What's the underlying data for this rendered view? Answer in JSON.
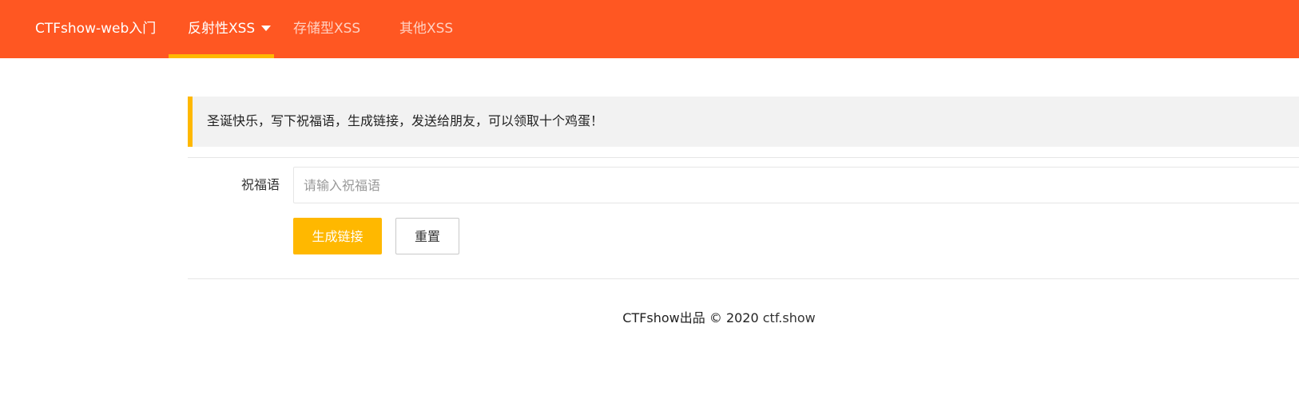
{
  "header": {
    "brand": "CTFshow-web入门",
    "nav": [
      {
        "label": "反射性XSS",
        "active": true,
        "has_dropdown": true
      },
      {
        "label": "存储型XSS",
        "active": false
      },
      {
        "label": "其他XSS",
        "active": false
      }
    ],
    "colors": {
      "bar": "#ff5722",
      "accent": "#ffb800"
    }
  },
  "notice": {
    "text": "圣诞快乐，写下祝福语，生成链接，发送给朋友，可以领取十个鸡蛋！"
  },
  "form": {
    "label": "祝福语",
    "input": {
      "value": "",
      "placeholder": "请输入祝福语"
    },
    "submit_label": "生成链接",
    "reset_label": "重置"
  },
  "footer": {
    "text": "CTFshow出品 © 2020 ",
    "link": "ctf.show"
  }
}
